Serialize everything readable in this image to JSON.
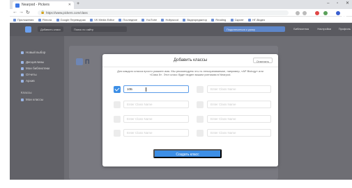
{
  "browser": {
    "tab_title": "Nearpod - Pickers",
    "url": "https://www.pickers.com/class",
    "bookmarks": [
      "Приложения",
      "Filmora",
      "Google Переводчик",
      "VK Media Editor",
      "Последние",
      "YouTube",
      "Hollywood",
      "Видеоредактор",
      "Reading",
      "Скрипт",
      "НГ-Видео"
    ]
  },
  "app": {
    "header_button": "Добавить класс",
    "search_placeholder": "Поиск по сайту",
    "primary_button": "Подключиться к уроку",
    "link_1": "Библиотека",
    "link_2": "Настройки",
    "link_3": "Профиль"
  },
  "sidebar": {
    "items": [
      "Новый выбор",
      "Дисциплины",
      "Мои библиотеки",
      "Отчеты",
      "Архив"
    ],
    "section_title": "Классы",
    "class_item": "Мои классы"
  },
  "page": {
    "heading": "П"
  },
  "modal": {
    "title": "Добавить классы",
    "cancel": "Отменить",
    "description": "Для каждого класса просто укажите имя. Мы рекомендуем что-то легкоузнаваемое, например, «AP Biology» или «Class 5». Этот класс будет виден вашим ученикам в Nearpod.",
    "placeholder": "Enter Class Name",
    "rows": [
      {
        "left_checked": true,
        "left_value": "10Б"
      },
      {
        "left_checked": false,
        "left_value": ""
      },
      {
        "left_checked": false,
        "left_value": ""
      },
      {
        "left_checked": false,
        "left_value": ""
      }
    ],
    "create_button": "Создать класс"
  },
  "colors": {
    "accent": "#3d8fe6",
    "overlay": "#6e6e74"
  }
}
